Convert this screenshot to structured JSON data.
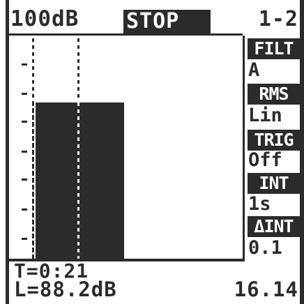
{
  "header": {
    "level_range": "100dB",
    "status": "STOP",
    "channels": "1-2"
  },
  "panel": [
    {
      "label": "FILT",
      "value": "A"
    },
    {
      "label": "RMS",
      "value": "Lin"
    },
    {
      "label": "TRIG",
      "value": "Off"
    },
    {
      "label": "INT",
      "value": "1s"
    },
    {
      "label": "ΔINT",
      "value": "0.1"
    }
  ],
  "footer": {
    "time": "T=0:21",
    "level": "L=88.2dB",
    "value": "16.14"
  },
  "chart_data": {
    "type": "bar",
    "categories": [
      ""
    ],
    "values": [
      88.2
    ],
    "ylim": [
      0,
      100
    ],
    "grid": false
  },
  "colors": {
    "ink": "#2b2b2b",
    "background": "#ffffff"
  }
}
